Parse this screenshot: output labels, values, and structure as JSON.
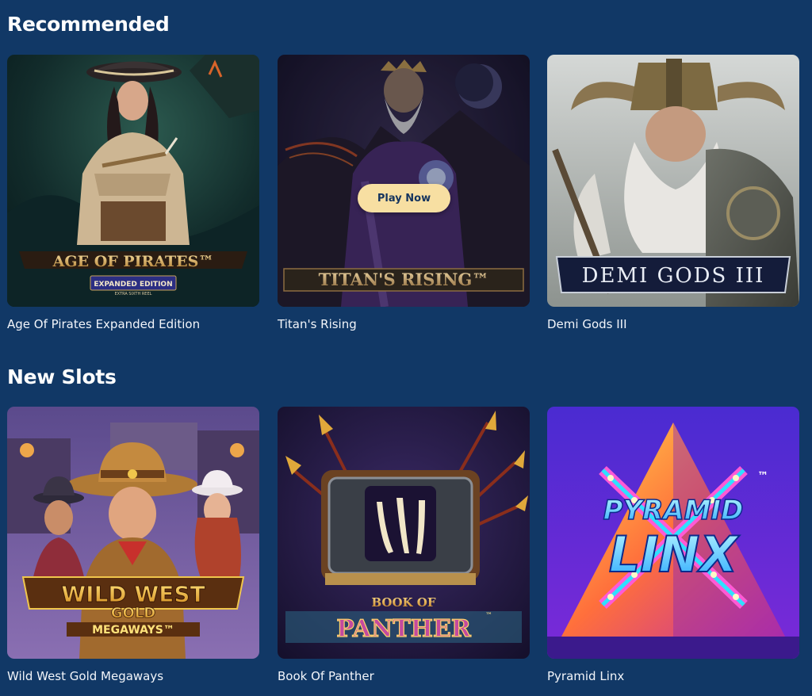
{
  "sections": [
    {
      "title": "Recommended",
      "games": [
        {
          "name": "Age Of Pirates Expanded Edition",
          "logo": "AGE OF PIRATES™",
          "sub1": "EXPANDED EDITION",
          "sub2": "EXTRA SIXTH REEL"
        },
        {
          "name": "Titan's Rising",
          "logo": "TITAN'S RISING™",
          "play_label": "Play Now"
        },
        {
          "name": "Demi Gods III",
          "logo": "DEMI GODS III"
        }
      ]
    },
    {
      "title": "New Slots",
      "games": [
        {
          "name": "Wild West Gold Megaways",
          "logo1": "WILD WEST",
          "logo2": "GOLD",
          "logo3": "MEGAWAYS™"
        },
        {
          "name": "Book Of Panther",
          "logo1": "BOOK OF",
          "logo2": "PANTHER",
          "tm": "™"
        },
        {
          "name": "Pyramid Linx",
          "logo1": "PYRAMID",
          "logo2": "LINX",
          "tm": "™"
        }
      ]
    }
  ],
  "colors": {
    "page_background": "#113866",
    "play_button": "#f7dfa2",
    "play_button_text": "#15345e"
  }
}
